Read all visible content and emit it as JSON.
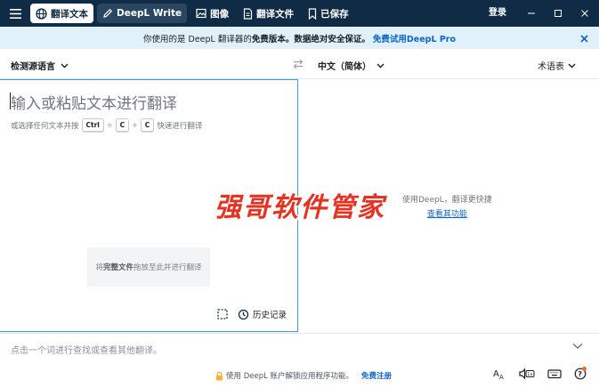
{
  "titlebar": {
    "tabs": [
      {
        "label": "翻译文本",
        "icon": "globe-icon",
        "active": true
      },
      {
        "label": "DeepL Write",
        "icon": "pencil-icon",
        "active": false
      },
      {
        "label": "图像",
        "icon": "image-icon",
        "active": false
      },
      {
        "label": "翻译文件",
        "icon": "document-icon",
        "active": false
      },
      {
        "label": "已保存",
        "icon": "bookmark-icon",
        "active": false
      }
    ],
    "login_label": "登录"
  },
  "banner": {
    "prefix": "你使用的是 DeepL 翻译器的",
    "bold": "免费版本。数据绝对安全保证。",
    "link": "免费试用DeepL Pro"
  },
  "languages": {
    "source": "检测源语言",
    "target": "中文（简体）",
    "glossary": "术语表"
  },
  "source_pane": {
    "placeholder": "输入或粘贴文本进行翻译",
    "shortcut_prefix": "或选择任何文本并按",
    "key_ctrl": "Ctrl",
    "key_c1": "C",
    "key_c2": "C",
    "shortcut_suffix": "快速进行翻译",
    "dropzone_prefix": "将",
    "dropzone_bold": "完整文件",
    "dropzone_suffix": "拖放至此并进行翻译",
    "history_label": "历史记录"
  },
  "target_pane": {
    "promo_text": "使用DeepL，翻译更快捷",
    "promo_link": "查看其功能"
  },
  "watermark": "强哥软件管家",
  "dictionary": {
    "placeholder": "点击一个词进行查找或查看其他翻译。"
  },
  "footer": {
    "message": "使用 DeepL 账户解锁应用程序功能。",
    "link": "免费注册"
  },
  "colors": {
    "titlebar": "#0f2b46",
    "banner": "#e1f1fa",
    "accent": "#0f64c8",
    "focus_border": "#3aa0d8",
    "watermark": "#e53322"
  }
}
